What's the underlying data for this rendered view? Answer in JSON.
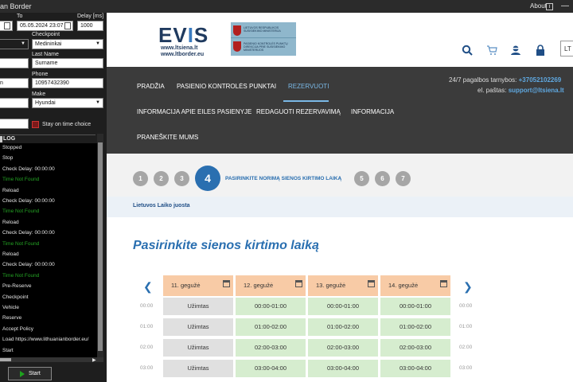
{
  "window": {
    "title": "an Border",
    "about": "About",
    "info_icon": "info-icon",
    "minimize": "—"
  },
  "left_panel": {
    "to_label": "To",
    "to_value": "05.05.2024 23:07",
    "delay_label": "Delay [ms]",
    "delay_value": "1000",
    "checkpoint_label": "Checkpoint",
    "checkpoint_value": "Medininkai",
    "last_name_label": "Last Name",
    "last_name_value": "Surname",
    "phone_label": "Phone",
    "phone_value": "10957432390",
    "partial_text": "n",
    "make_label": "Make",
    "make_value": "Hyundai",
    "stay_label": "Stay on time choice",
    "log_label": "LOG",
    "log": [
      {
        "t": "Stopped",
        "g": false
      },
      {
        "t": "Stop",
        "g": false
      },
      {
        "t": "Check Delay: 00:00:00",
        "g": false
      },
      {
        "t": "Time Not Found",
        "g": true
      },
      {
        "t": "Reload",
        "g": false
      },
      {
        "t": "Check Delay: 00:00:00",
        "g": false
      },
      {
        "t": "Time Not Found",
        "g": true
      },
      {
        "t": "Reload",
        "g": false
      },
      {
        "t": "Check Delay: 00:00:00",
        "g": false
      },
      {
        "t": "Time Not Found",
        "g": true
      },
      {
        "t": "Reload",
        "g": false
      },
      {
        "t": "Check Delay: 00:00:00",
        "g": false
      },
      {
        "t": "Time Not Found",
        "g": true
      },
      {
        "t": "Pre-Reserve",
        "g": false
      },
      {
        "t": "Checkpoint",
        "g": false
      },
      {
        "t": "Vehicle",
        "g": false
      },
      {
        "t": "Reserve",
        "g": false
      },
      {
        "t": "Accept Policy",
        "g": false
      },
      {
        "t": "Load https://www.lithuanianborder.eu/",
        "g": false
      },
      {
        "t": "Start",
        "g": false
      }
    ],
    "start_label": "Start"
  },
  "website": {
    "logo_text": "EVIS",
    "logo_sub1": "www.ltsiena.lt",
    "logo_sub2": "www.ltborder.eu",
    "crest_text1": "LIETUVOS RESPUBLIKOS SUSISIEKIMO MINISTERIJA",
    "crest_text2": "PASIENIO KONTROLĖS PUNKTŲ DIREKCIJA PRIE SUSISIEKIMO MINISTERIJOS",
    "lang": "LT",
    "nav": {
      "home": "PRADŽIA",
      "checkpoints": "PASIENIO KONTROLĖS PUNKTAI",
      "reserve": "REZERVUOTI",
      "queue_info": "INFORMACIJA APIE EILES PASIENYJE",
      "edit": "REDAGUOTI REZERVAVIMĄ",
      "info": "INFORMACIJA",
      "contact": "PRANEŠKITE MUMS"
    },
    "contact_line1_label": "24/7 pagalbos tarnybos: ",
    "contact_phone": "+37052102269",
    "contact_line2_label": "el. paštas: ",
    "contact_email": "support@ltsiena.lt",
    "steps": [
      "1",
      "2",
      "3",
      "4",
      "5",
      "6",
      "7"
    ],
    "active_step_label": "PASIRINKITE NORIMĄ SIENOS KIRTIMO LAIKĄ",
    "zone_label": "Lietuvos Laiko juosta",
    "page_title": "Pasirinkite sienos kirtimo laiką",
    "days": [
      "11. gegužė",
      "12. gegužė",
      "13. gegužė",
      "14. gegužė"
    ],
    "times": [
      "00:00",
      "01:00",
      "02:00",
      "03:00"
    ],
    "rows": [
      [
        "Užimtas",
        "00:00-01:00",
        "00:00-01:00",
        "00:00-01:00"
      ],
      [
        "Užimtas",
        "01:00-02:00",
        "01:00-02:00",
        "01:00-02:00"
      ],
      [
        "Užimtas",
        "02:00-03:00",
        "02:00-03:00",
        "02:00-03:00"
      ],
      [
        "Užimtas",
        "03:00-04:00",
        "03:00-04:00",
        "03:00-04:00"
      ]
    ]
  }
}
